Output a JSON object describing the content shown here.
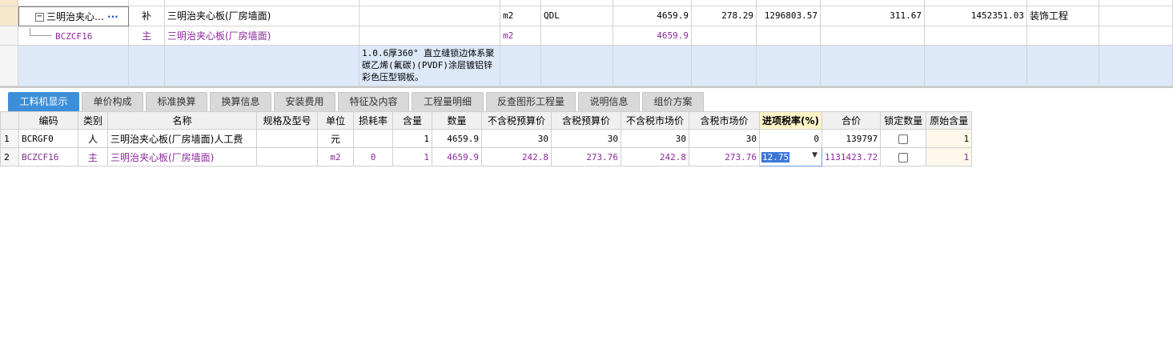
{
  "upper": {
    "row1": {
      "toggle": "−",
      "name": "三明治夹心…",
      "more": "···",
      "category": "补",
      "title": "三明治夹心板(厂房墙面)",
      "unit": "m2",
      "qty_expr": "QDL",
      "quantity": "4659.9",
      "price": "278.29",
      "total": "1296803.57",
      "market_price": "311.67",
      "market_total": "1452351.03",
      "profession": "装饰工程"
    },
    "row2": {
      "code": "BCZCF16",
      "category": "主",
      "title": "三明治夹心板(厂房墙面)",
      "unit": "m2",
      "quantity": "4659.9"
    },
    "row3": {
      "description": "1.0.6厚360° 直立缝锁边体系聚碳乙烯(氟碳)(PVDF)涂层镀铝锌彩色压型钢板。"
    }
  },
  "tabs": [
    {
      "label": "工料机显示",
      "active": true
    },
    {
      "label": "单价构成"
    },
    {
      "label": "标准换算"
    },
    {
      "label": "换算信息"
    },
    {
      "label": "安装费用"
    },
    {
      "label": "特征及内容"
    },
    {
      "label": "工程量明细"
    },
    {
      "label": "反查图形工程量"
    },
    {
      "label": "说明信息"
    },
    {
      "label": "组价方案"
    }
  ],
  "grid": {
    "headers": [
      "编码",
      "类别",
      "名称",
      "规格及型号",
      "单位",
      "损耗率",
      "含量",
      "数量",
      "不含税预算价",
      "含税预算价",
      "不含税市场价",
      "含税市场价",
      "进项税率(%)",
      "合价",
      "锁定数量",
      "原始含量"
    ],
    "rows": [
      {
        "no": "1",
        "code": "BCRGF0",
        "type": "人",
        "name": "三明治夹心板(厂房墙面)人工费",
        "spec": "",
        "unit": "元",
        "loss": "",
        "content": "1",
        "qty": "4659.9",
        "budget_ex": "30",
        "budget_in": "30",
        "market_ex": "30",
        "market_in": "30",
        "tax": "0",
        "total": "139797",
        "orig": "1"
      },
      {
        "no": "2",
        "code": "BCZCF16",
        "type": "主",
        "name": "三明治夹心板(厂房墙面)",
        "spec": "",
        "unit": "m2",
        "loss": "0",
        "content": "1",
        "qty": "4659.9",
        "budget_ex": "242.8",
        "budget_in": "273.76",
        "market_ex": "242.8",
        "market_in": "273.76",
        "tax": "12.75",
        "total": "1131423.72",
        "orig": "1"
      }
    ]
  },
  "colors": {
    "accent": "#3c8fd8",
    "purple": "#8b2a9a",
    "upper_selected_bg": "#dde9f8"
  }
}
